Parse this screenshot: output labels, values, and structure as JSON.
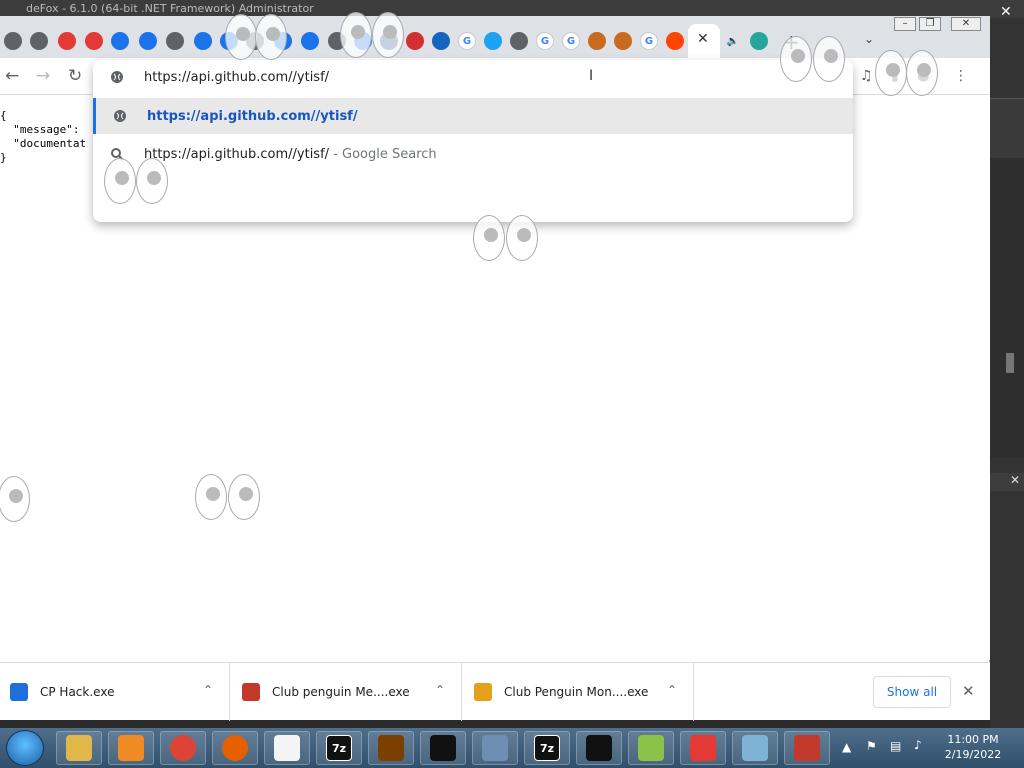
{
  "background_window": {
    "title": "deFox - 6.1.0 (64-bit .NET Framework) Administrator"
  },
  "browser": {
    "tabs_favicons": [
      "globe",
      "globe",
      "youtube",
      "youtube",
      "edge",
      "edge",
      "globe",
      "edge",
      "edge",
      "globe",
      "edge",
      "edge",
      "globe",
      "edge",
      "ov",
      "adobe",
      "cloud",
      "google",
      "twitter",
      "globe",
      "google",
      "google",
      "app",
      "app",
      "google",
      "reddit",
      "active",
      "audio",
      "heart"
    ],
    "window_controls": {
      "minimize": "–",
      "restore": "❐",
      "close": "✕"
    },
    "new_tab": "+",
    "address_value": "https://api.github.com//ytisf/",
    "suggestions": [
      {
        "text": "https://api.github.com//ytisf/",
        "sub": "",
        "icon": "globe-icon"
      },
      {
        "text": "https://api.github.com//ytisf/",
        "sub": " - Google Search",
        "icon": "search-icon"
      }
    ],
    "json_lines": [
      "{",
      "  \"message\":",
      "  \"documentat",
      "}"
    ]
  },
  "downloads": {
    "items": [
      {
        "name": "CP Hack.exe",
        "icon_color": "#1e6fd9"
      },
      {
        "name": "Club penguin Me....exe",
        "icon_color": "#c0392b"
      },
      {
        "name": "Club Penguin Mon....exe",
        "icon_color": "#e6a11c"
      }
    ],
    "show_all": "Show all",
    "close": "✕"
  },
  "taskbar": {
    "items": [
      "explorer",
      "media",
      "chrome",
      "firefox",
      "list",
      "7z",
      "pirate",
      "penguin",
      "windows",
      "7z",
      "cmd",
      "notepad",
      "lifebuoy",
      "app",
      "click-here"
    ],
    "clock_time": "11:00 PM",
    "clock_date": "2/19/2022"
  }
}
